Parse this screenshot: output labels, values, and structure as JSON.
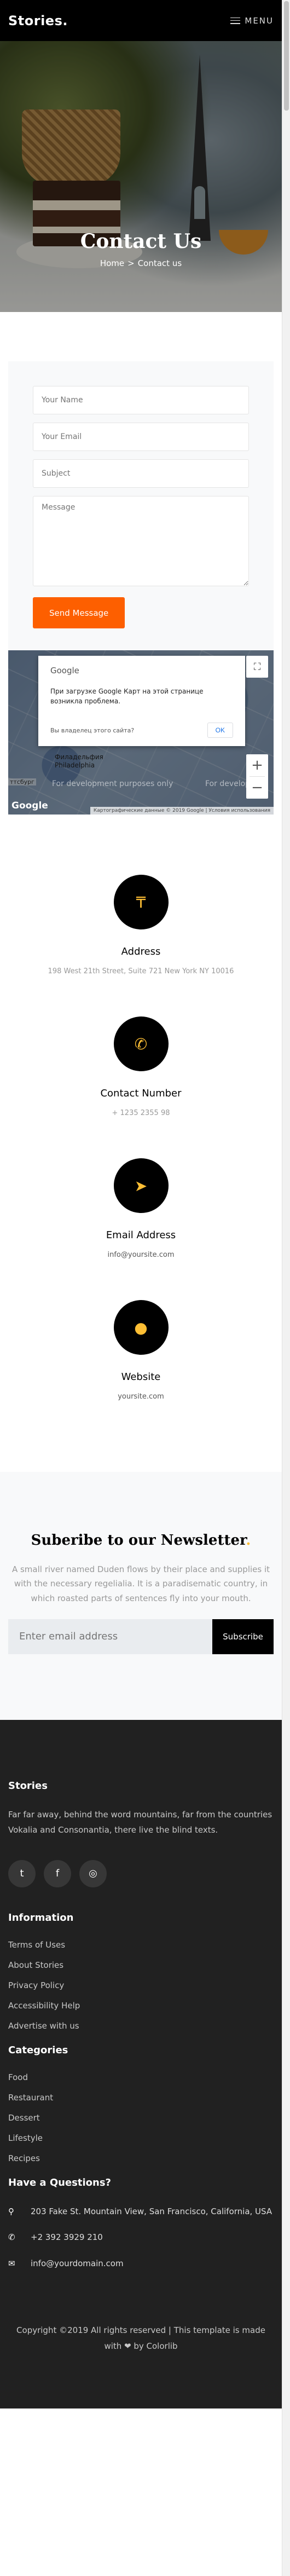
{
  "header": {
    "logo": "Stories.",
    "menu_label": "MENU"
  },
  "hero": {
    "title": "Contact Us",
    "breadcrumb_home": "Home",
    "breadcrumb_sep": ">",
    "breadcrumb_current": "Contact us"
  },
  "form": {
    "name_placeholder": "Your Name",
    "email_placeholder": "Your Email",
    "subject_placeholder": "Subject",
    "message_placeholder": "Message",
    "submit_label": "Send Message",
    "submit_color": "#fd5f00"
  },
  "map": {
    "dialog_brand": "Google",
    "dialog_message": "При загрузке Google Карт на этой странице возникла проблема.",
    "dialog_question": "Вы владелец этого сайта?",
    "dialog_ok": "OK",
    "dev_text": "For development purposes only",
    "dev_text_2": "For developm",
    "city_label": "Филадельфия\nPhiladelphia",
    "left_label": "ттсбург",
    "google_logo": "Google",
    "attribution": "Картографические данные © 2019 Google | Условия использования",
    "fullscreen_icon": "fullscreen-icon",
    "zoom_in": "+",
    "zoom_out": "−"
  },
  "info": {
    "address_title": "Address",
    "address_text": "198 West 21th Street, Suite 721 New York NY 10016",
    "phone_title": "Contact Number",
    "phone_text": "+ 1235 2355 98",
    "email_title": "Email Address",
    "email_text": "info@yoursite.com",
    "website_title": "Website",
    "website_text": "yoursite.com",
    "icon_color": "#fdbe34"
  },
  "newsletter": {
    "title": "Suberibe to our Newsletter",
    "title_dot": ".",
    "text": "A small river named Duden flows by their place and supplies it with the necessary regelialia. It is a paradisematic country, in which roasted parts of sentences fly into your mouth.",
    "input_placeholder": "Enter email address",
    "button_label": "Subscribe"
  },
  "footer": {
    "about_title": "Stories",
    "about_text": "Far far away, behind the word mountains, far from the countries Vokalia and Consonantia, there live the blind texts.",
    "social_icons": [
      "twitter-icon",
      "facebook-icon",
      "instagram-icon"
    ],
    "information_title": "Information",
    "information_links": [
      "Terms of Uses",
      "About Stories",
      "Privacy Policy",
      "Accessibility Help",
      "Advertise with us"
    ],
    "categories_title": "Categories",
    "categories_links": [
      "Food",
      "Restaurant",
      "Dessert",
      "Lifestyle",
      "Recipes"
    ],
    "questions_title": "Have a Questions?",
    "address": "203 Fake St. Mountain View, San Francisco, California, USA",
    "phone": "+2 392 3929 210",
    "email": "info@yourdomain.com",
    "copyright": "Copyright ©2019 All rights reserved | This template is made with ❤ by Colorlib"
  }
}
